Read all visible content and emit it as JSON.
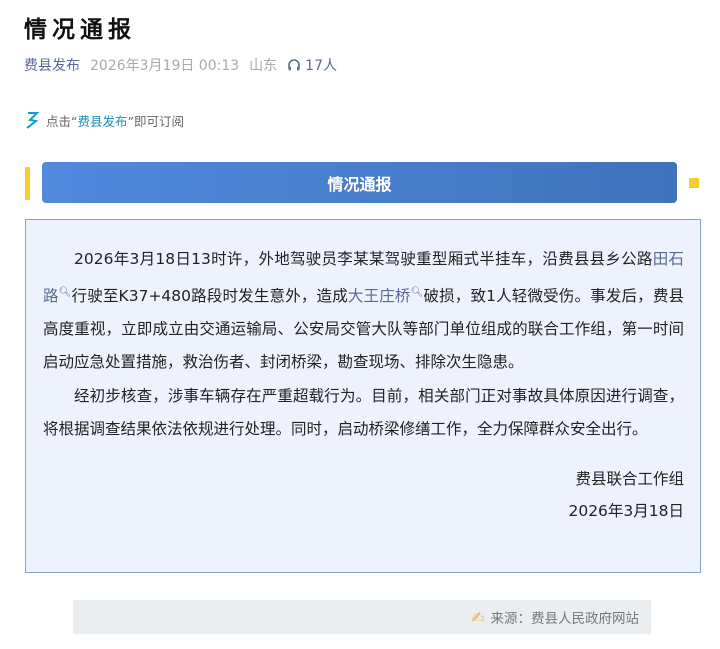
{
  "title": "情况通报",
  "meta": {
    "source": "费县发布",
    "datetime": "2026年3月19日 00:13",
    "location": "山东",
    "listeners": "17人"
  },
  "subscribe": {
    "prefix": "点击",
    "quote_open": "“",
    "account": "费县发布",
    "quote_close": "”",
    "suffix": "即可订阅"
  },
  "banner": "情况通报",
  "body": {
    "p1_a": "2026年3月18日13时许，外地驾驶员李某某驾驶重型厢式半挂车，沿费县县乡公路",
    "link1": "田石路",
    "p1_b": "行驶至K37+480路段时发生意外，造成",
    "link2": "大王庄桥",
    "p1_c": "破损，致1人轻微受伤。事发后，费县高度重视，立即成立由交通运输局、公安局交管大队等部门单位组成的联合工作组，第一时间启动应急处置措施，救治伤者、封闭桥梁，勘查现场、排除次生隐患。",
    "p2": "经初步核查，涉事车辆存在严重超载行为。目前，相关部门正对事故具体原因进行调查，将根据调查结果依法依规进行处理。同时，启动桥梁修缮工作，全力保障群众安全出行。",
    "signer": "费县联合工作组",
    "date": "2026年3月18日"
  },
  "footer": {
    "source": "来源：费县人民政府网站"
  },
  "colors": {
    "accent": "#4a82d3",
    "yellow": "#f7cf2a",
    "link": "#576b95"
  }
}
